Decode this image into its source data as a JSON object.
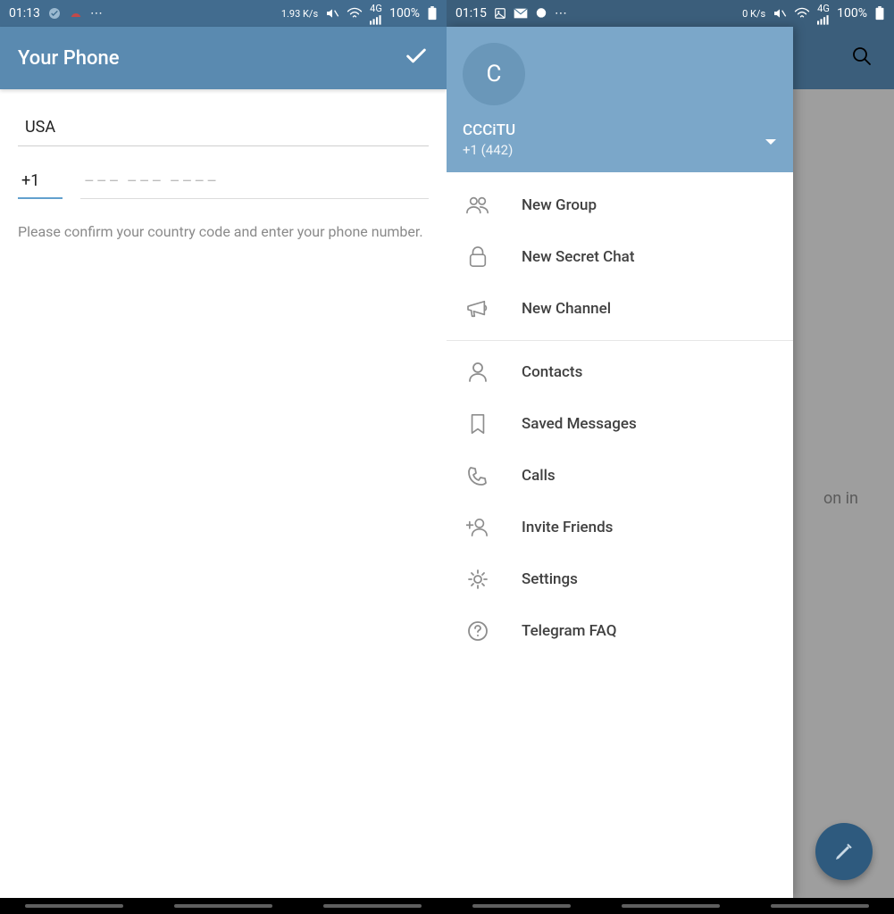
{
  "left": {
    "status": {
      "time": "01:13",
      "speed": "1.93 K/s",
      "signal": "4G",
      "battery": "100%"
    },
    "header": {
      "title": "Your Phone"
    },
    "country": "USA",
    "code": "+1",
    "number_placeholder": "––– ––– ––––",
    "hint": "Please confirm your country code and enter your phone number."
  },
  "right": {
    "status": {
      "time": "01:15",
      "speed": "0 K/s",
      "signal": "4G",
      "battery": "100%"
    },
    "bg_text": "on in",
    "drawer": {
      "avatar_letter": "C",
      "user_name": "CCCiTU",
      "user_phone": "+1 (442)",
      "menu_group1": [
        {
          "icon": "group",
          "label": "New Group"
        },
        {
          "icon": "lock",
          "label": "New Secret Chat"
        },
        {
          "icon": "megaphone",
          "label": "New Channel"
        }
      ],
      "menu_group2": [
        {
          "icon": "person",
          "label": "Contacts"
        },
        {
          "icon": "bookmark",
          "label": "Saved Messages"
        },
        {
          "icon": "phone",
          "label": "Calls"
        },
        {
          "icon": "adduser",
          "label": "Invite Friends"
        },
        {
          "icon": "gear",
          "label": "Settings"
        },
        {
          "icon": "help",
          "label": "Telegram FAQ"
        }
      ]
    }
  }
}
